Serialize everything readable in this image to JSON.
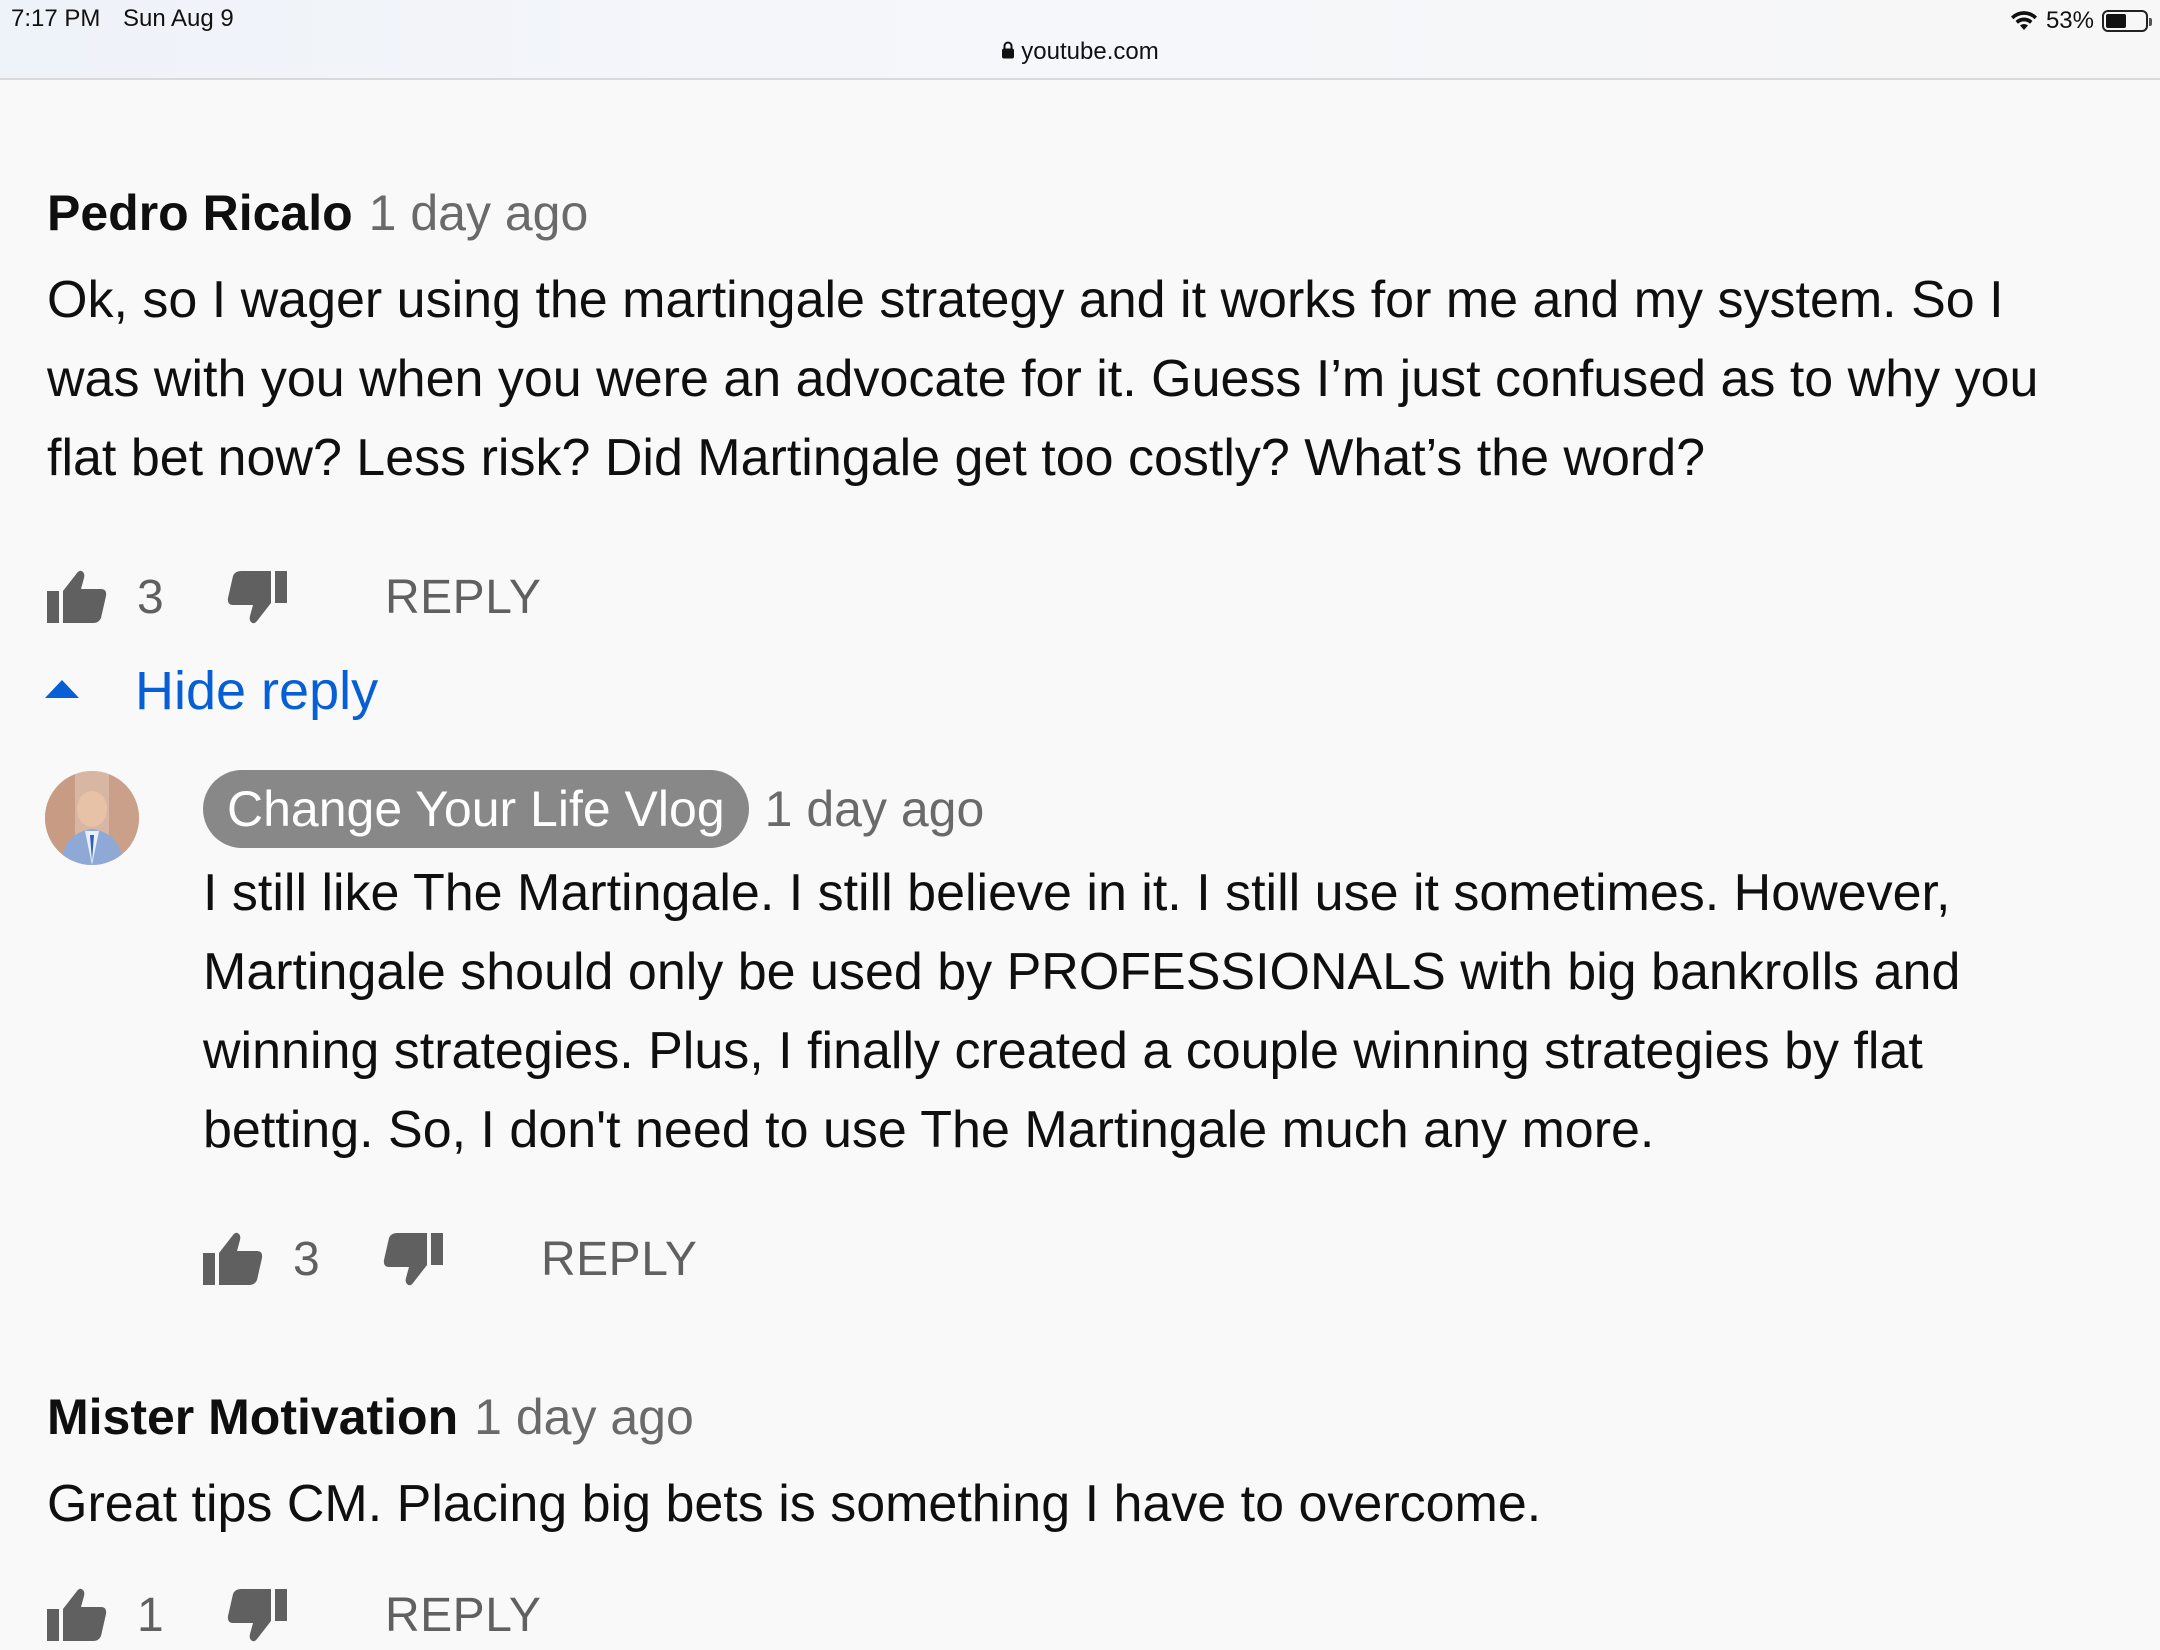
{
  "status_bar": {
    "time": "7:17 PM",
    "date": "Sun Aug 9",
    "battery": "53%",
    "battery_level": 0.53,
    "url": "youtube.com"
  },
  "comments": [
    {
      "author": "Pedro Ricalo",
      "timestamp": "1 day ago",
      "text": "Ok, so I wager using the martingale strategy and it works for me and my system. So I\nwas with you when you were an advocate for it. Guess I’m just confused as to why you\nflat bet now? Less risk? Did Martingale get too costly? What’s the word?",
      "likes": "3",
      "reply_label": "REPLY"
    },
    {
      "author": "Mister Motivation",
      "timestamp": "1 day ago",
      "text": "Great tips CM. Placing big bets is something I have to overcome.",
      "likes": "1",
      "reply_label": "REPLY"
    }
  ],
  "hide_reply_label": "Hide reply",
  "reply": {
    "author": "Change Your Life Vlog",
    "timestamp": "1 day ago",
    "text": "I still like The Martingale. I still believe in it. I still use it sometimes. However,\nMartingale should only be used by PROFESSIONALS with big bankrolls and\nwinning strategies. Plus, I finally created a couple winning strategies by flat\nbetting. So, I don't need to use The Martingale much any more.",
    "likes": "3",
    "reply_label": "REPLY"
  },
  "icons": {
    "like": "thumbs-up-icon",
    "dislike": "thumbs-down-icon",
    "collapse": "caret-up-icon",
    "lock": "lock-icon",
    "wifi": "wifi-icon",
    "battery": "battery-icon"
  },
  "colors": {
    "link_blue": "#065fd4",
    "secondary_text": "#606060",
    "chip_gray": "#888888",
    "background": "#f9f9f9"
  }
}
